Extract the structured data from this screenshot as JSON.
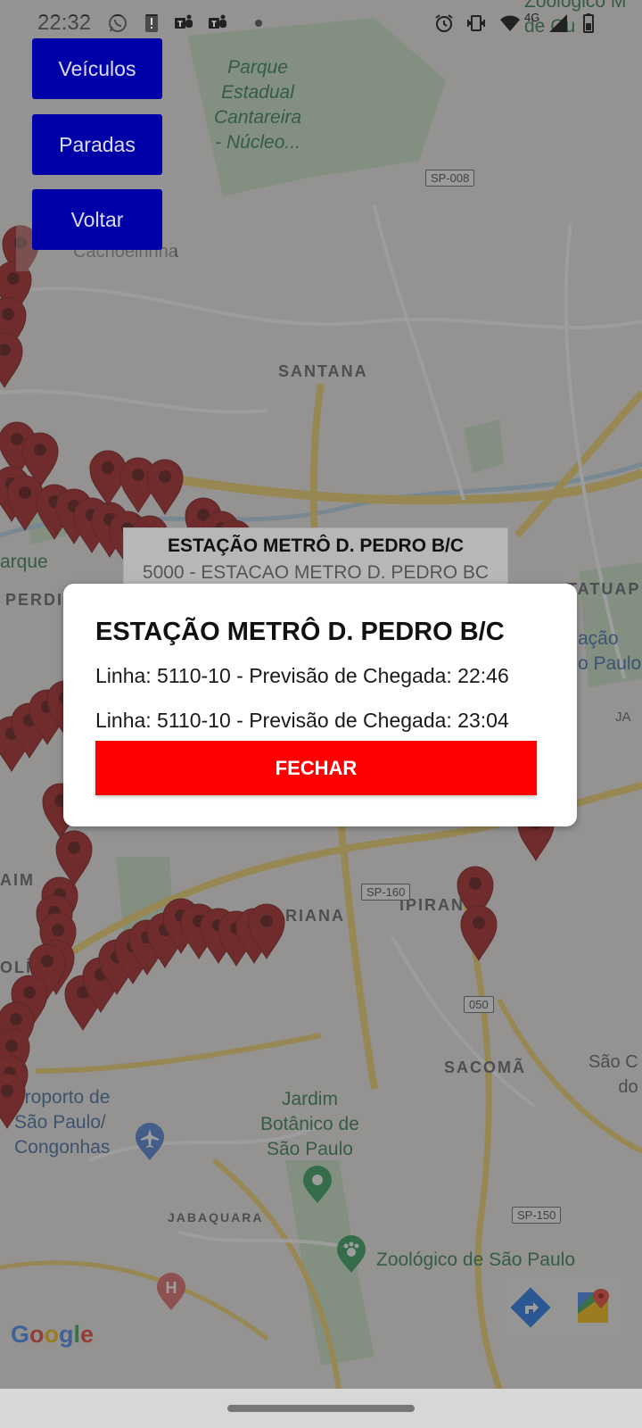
{
  "status_bar": {
    "time": "22:32",
    "left_icons": [
      "whatsapp-icon",
      "alert-icon",
      "teams-icon",
      "teams-icon",
      "dot-icon"
    ],
    "right_icons": [
      "alarm-icon",
      "vibrate-icon",
      "wifi-icon",
      "signal-icon",
      "battery-icon"
    ],
    "network": "4G"
  },
  "menu": {
    "vehicles_label": "Veículos",
    "stops_label": "Paradas",
    "back_label": "Voltar"
  },
  "map": {
    "labels": {
      "parque_estadual": "Parque\nEstadual\nCantareira\n- Núcleo...",
      "cachoeirinha": "Cachoeirinha",
      "santana": "SANTANA",
      "parque": "arque",
      "perdizes": "PERDI",
      "tatuape": "TATUAP",
      "estacao_sp": "ação\no Paulo",
      "ja": "JA",
      "aim": "AIM",
      "mariana": "ARIANA",
      "ipiranga": "IPIRAN",
      "olimpia": "OLÍ",
      "sacoma": "SACOMÃ",
      "sao_c": "São C\ndo",
      "aeroporto": "eroporto de\nSão Paulo/\nCongonhas",
      "jardim_botanico": "Jardim\nBotânico de\nSão Paulo",
      "jabaquara": "JABAQUARA",
      "zoologico": "Zoológico de São Paulo",
      "zoologico_top": "Zoológico M\nde Gu"
    },
    "shields": {
      "sp008": "SP-008",
      "sp160": "SP-160",
      "r050": "050",
      "sp150": "SP-150"
    },
    "google": "Google",
    "colors": {
      "pin": "#a51d1d",
      "pin_center": "#5e0d0d",
      "park": "#c6e2c4"
    }
  },
  "callout": {
    "title": "ESTAÇÃO METRÔ D. PEDRO B/C",
    "subtitle": "5000 - ESTACAO METRO D. PEDRO BC"
  },
  "dialog": {
    "title": "ESTAÇÃO METRÔ D. PEDRO B/C",
    "lines": [
      "Linha: 5110-10 - Previsão de Chegada: 22:46",
      "Linha: 5110-10 - Previsão de Chegada: 23:04"
    ],
    "close_label": "FECHAR",
    "close_color": "#ff0000"
  },
  "map_tools": [
    "directions-icon",
    "google-maps-icon"
  ]
}
